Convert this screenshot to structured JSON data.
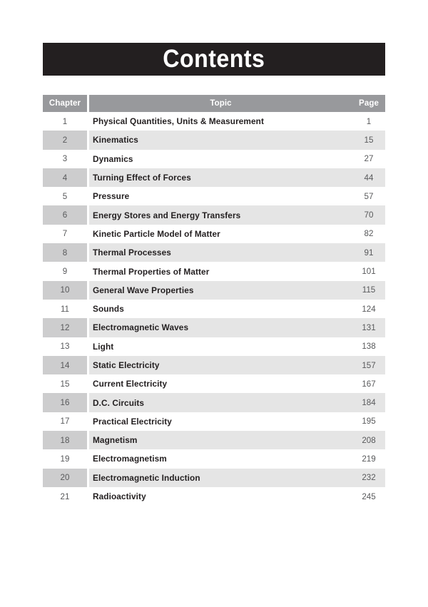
{
  "page": {
    "title": "Contents"
  },
  "table": {
    "headers": {
      "chapter": "Chapter",
      "topic": "Topic",
      "page": "Page"
    },
    "rows": [
      {
        "chapter": "1",
        "topic": "Physical Quantities, Units & Measurement",
        "page": "1",
        "shaded": false
      },
      {
        "chapter": "2",
        "topic": "Kinematics",
        "page": "15",
        "shaded": true
      },
      {
        "chapter": "3",
        "topic": "Dynamics",
        "page": "27",
        "shaded": false
      },
      {
        "chapter": "4",
        "topic": "Turning Effect of Forces",
        "page": "44",
        "shaded": true
      },
      {
        "chapter": "5",
        "topic": "Pressure",
        "page": "57",
        "shaded": false
      },
      {
        "chapter": "6",
        "topic": "Energy Stores and Energy Transfers",
        "page": "70",
        "shaded": true
      },
      {
        "chapter": "7",
        "topic": "Kinetic Particle Model of Matter",
        "page": "82",
        "shaded": false
      },
      {
        "chapter": "8",
        "topic": "Thermal Processes",
        "page": "91",
        "shaded": true
      },
      {
        "chapter": "9",
        "topic": "Thermal Properties of Matter",
        "page": "101",
        "shaded": false
      },
      {
        "chapter": "10",
        "topic": "General Wave Properties",
        "page": "115",
        "shaded": true
      },
      {
        "chapter": "11",
        "topic": "Sounds",
        "page": "124",
        "shaded": false
      },
      {
        "chapter": "12",
        "topic": "Electromagnetic Waves",
        "page": "131",
        "shaded": true
      },
      {
        "chapter": "13",
        "topic": "Light",
        "page": "138",
        "shaded": false
      },
      {
        "chapter": "14",
        "topic": "Static Electricity",
        "page": "157",
        "shaded": true
      },
      {
        "chapter": "15",
        "topic": "Current Electricity",
        "page": "167",
        "shaded": false
      },
      {
        "chapter": "16",
        "topic": "D.C. Circuits",
        "page": "184",
        "shaded": true
      },
      {
        "chapter": "17",
        "topic": "Practical Electricity",
        "page": "195",
        "shaded": false
      },
      {
        "chapter": "18",
        "topic": "Magnetism",
        "page": "208",
        "shaded": true
      },
      {
        "chapter": "19",
        "topic": "Electromagnetism",
        "page": "219",
        "shaded": false
      },
      {
        "chapter": "20",
        "topic": "Electromagnetic Induction",
        "page": "232",
        "shaded": true
      },
      {
        "chapter": "21",
        "topic": "Radioactivity",
        "page": "245",
        "shaded": false
      }
    ]
  },
  "colors": {
    "banner_background": "#231f20",
    "banner_text": "#ffffff",
    "header_background": "#98999c",
    "row_shaded": "#e5e5e5",
    "chapter_shaded": "#cdcdce",
    "topic_text": "#231f20",
    "number_text": "#58595b"
  }
}
